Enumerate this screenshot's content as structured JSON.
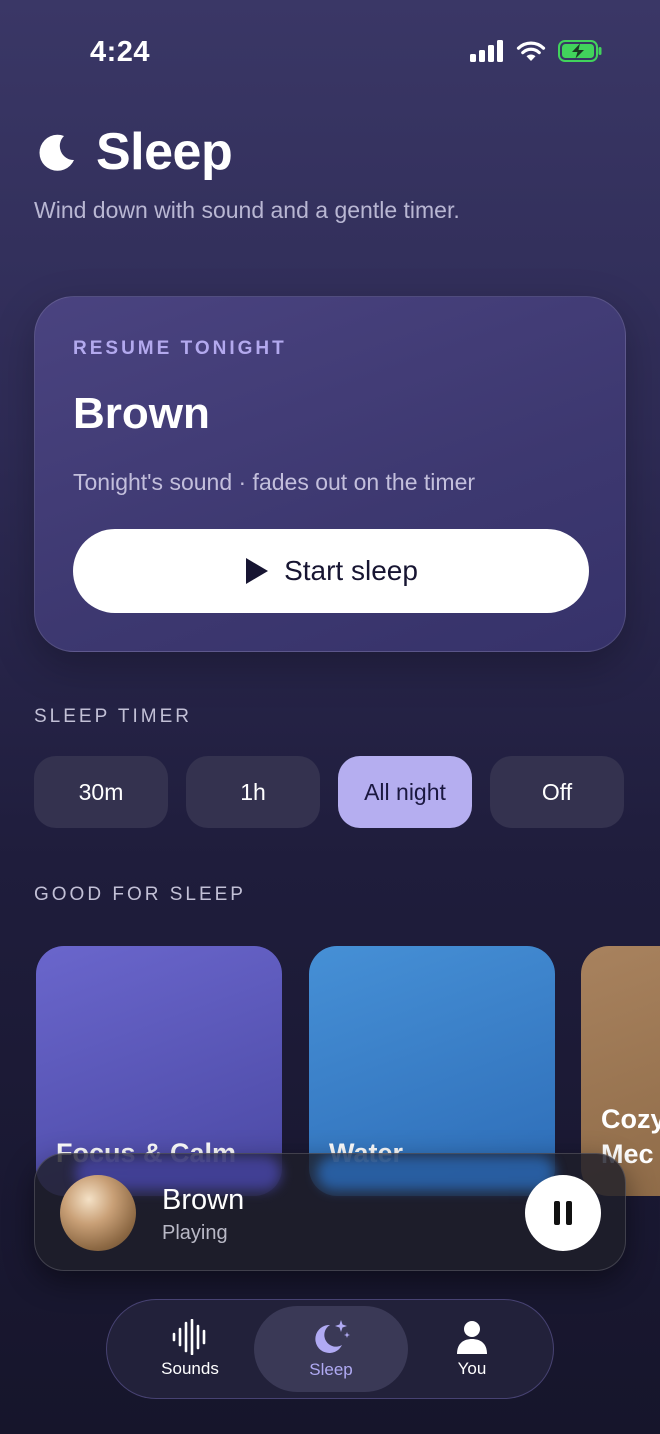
{
  "status_bar": {
    "time": "4:24"
  },
  "header": {
    "title": "Sleep",
    "subtitle": "Wind down with sound and a gentle timer."
  },
  "resume": {
    "kicker": "RESUME TONIGHT",
    "sound_name": "Brown",
    "description": "Tonight's sound · fades out on the timer",
    "button_label": "Start sleep"
  },
  "timer": {
    "section_label": "SLEEP TIMER",
    "options": [
      "30m",
      "1h",
      "All night",
      "Off"
    ],
    "selected": "All night"
  },
  "good_for_sleep": {
    "section_label": "GOOD FOR SLEEP",
    "tiles": [
      {
        "label": "Focus & Calm",
        "color_top": "#6a66cc",
        "color_bottom": "#4a48a3"
      },
      {
        "label": "Water",
        "color_top": "#4690d6",
        "color_bottom": "#2d6cb7"
      },
      {
        "label": "Cozy Mec",
        "line1": "Cozy",
        "line2": "Mec",
        "color_top": "#a8825e",
        "color_bottom": "#8a6744"
      }
    ]
  },
  "now_playing": {
    "title": "Brown",
    "status": "Playing"
  },
  "tab_bar": {
    "tabs": [
      {
        "label": "Sounds",
        "icon": "waveform-icon"
      },
      {
        "label": "Sleep",
        "icon": "moon-stars-icon"
      },
      {
        "label": "You",
        "icon": "person-icon"
      }
    ],
    "active": "Sleep"
  },
  "colors": {
    "accent": "#b5aef0",
    "kicker": "#b3a9ee",
    "battery": "#41d35c"
  }
}
